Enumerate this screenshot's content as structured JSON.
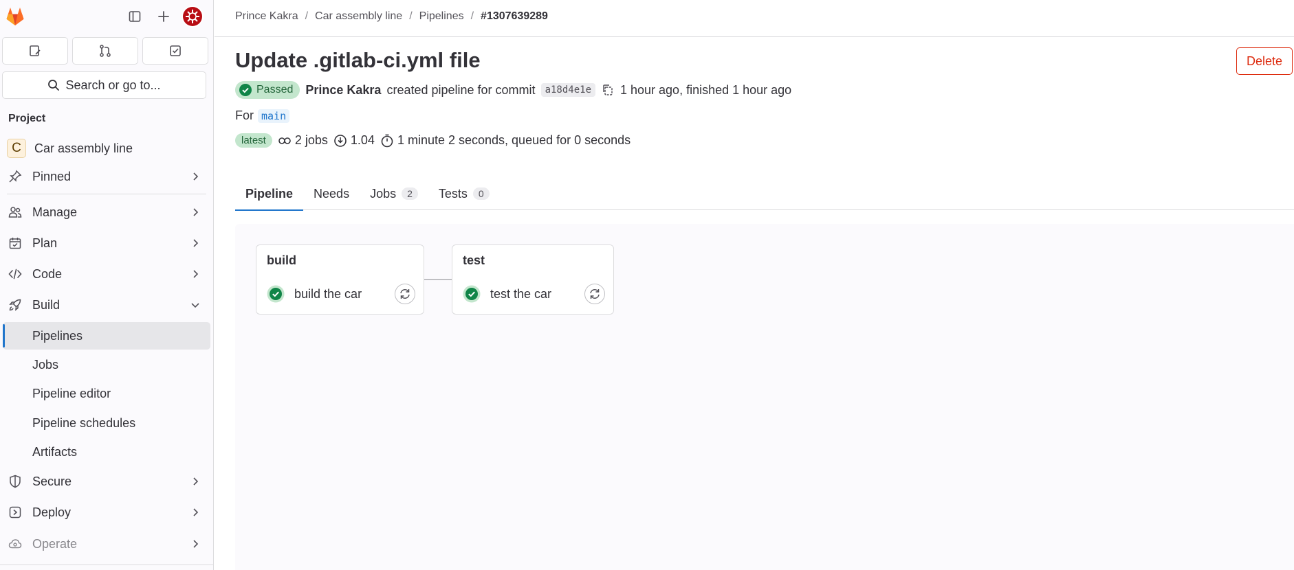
{
  "sidebar": {
    "search_label": "Search or go to...",
    "section_title": "Project",
    "project": {
      "initial": "C",
      "name": "Car assembly line"
    },
    "items": [
      {
        "label": "Pinned",
        "icon": "pin-icon"
      },
      {
        "label": "Manage",
        "icon": "users-icon"
      },
      {
        "label": "Plan",
        "icon": "calendar-icon"
      },
      {
        "label": "Code",
        "icon": "code-icon"
      },
      {
        "label": "Build",
        "icon": "rocket-icon"
      }
    ],
    "build_sub": [
      {
        "label": "Pipelines",
        "active": true
      },
      {
        "label": "Jobs"
      },
      {
        "label": "Pipeline editor"
      },
      {
        "label": "Pipeline schedules"
      },
      {
        "label": "Artifacts"
      }
    ],
    "items_after": [
      {
        "label": "Secure",
        "icon": "shield-icon"
      },
      {
        "label": "Deploy",
        "icon": "deploy-icon"
      },
      {
        "label": "Operate",
        "icon": "cloud-icon"
      }
    ]
  },
  "breadcrumbs": [
    "Prince Kakra",
    "Car assembly line",
    "Pipelines",
    "#1307639289"
  ],
  "pipeline": {
    "title": "Update .gitlab-ci.yml file",
    "delete_label": "Delete",
    "status": "Passed",
    "author": "Prince Kakra",
    "action_text": "created pipeline for commit",
    "commit_sha": "a18d4e1e",
    "time_text": "1 hour ago, finished 1 hour ago",
    "for_label": "For",
    "ref": "main",
    "latest_badge": "latest",
    "jobs_text": "2 jobs",
    "coverage": "1.04",
    "duration_text": "1 minute 2 seconds, queued for 0 seconds"
  },
  "tabs": [
    {
      "label": "Pipeline",
      "active": true
    },
    {
      "label": "Needs"
    },
    {
      "label": "Jobs",
      "count": "2"
    },
    {
      "label": "Tests",
      "count": "0"
    }
  ],
  "stages": [
    {
      "name": "build",
      "job": "build the car"
    },
    {
      "name": "test",
      "job": "test the car"
    }
  ],
  "colors": {
    "accent": "#1f75cb",
    "success": "#108548",
    "danger": "#dd2b0e",
    "success_bg": "#c3e6cd"
  }
}
